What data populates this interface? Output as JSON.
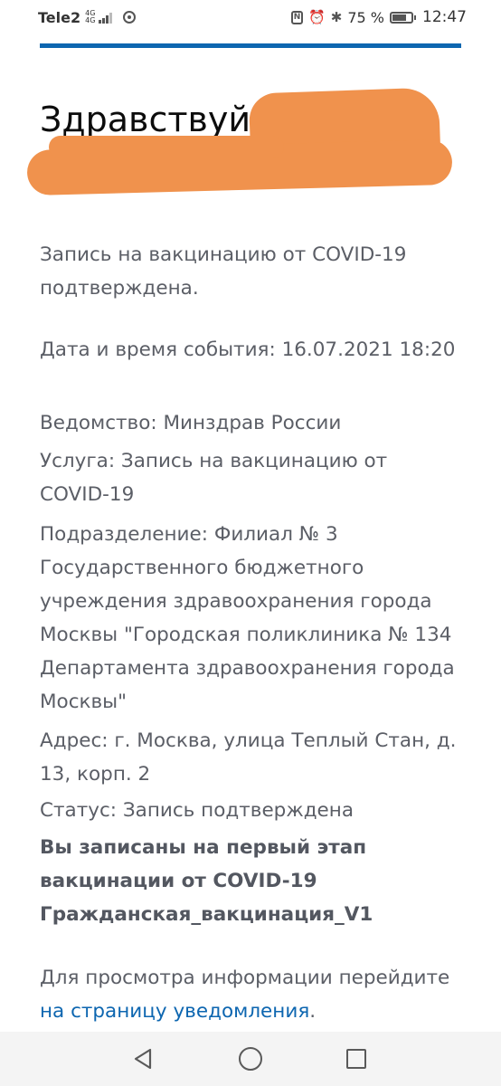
{
  "status_bar": {
    "carrier": "Tele2",
    "network_top": "4G",
    "network_bottom": "4G",
    "battery": "75 %",
    "time": "12:47",
    "icons": [
      "signal-icon",
      "chrome-icon",
      "nfc-icon",
      "alarm-icon",
      "bluetooth-icon",
      "battery-icon"
    ]
  },
  "email": {
    "greeting": "Здравствуйте,",
    "paragraphs": {
      "confirm": "Запись на вакцинацию от COVID-19 подтверждена.",
      "datetime": "Дата и время события: 16.07.2021 18:20",
      "department": "Ведомство: Минздрав России",
      "service": "Услуга: Запись на вакцинацию от COVID-19",
      "division": "Подразделение: Филиал № 3 Государственного бюджетного учреждения здравоохранения города Москвы \"Городская поликлиника № 134 Департамента здравоохранения города Москвы\"",
      "address": "Адрес: г. Москва, улица Теплый Стан, д. 13, корп. 2",
      "status": "Статус: Запись подтверждена",
      "stage": "Вы записаны на первый этап вакцинации от COVID-19 Гражданская_вакцинация_V1",
      "info_prefix": "Для просмотра информации перейдите ",
      "info_link": "на страницу уведомления",
      "info_suffix": "."
    }
  },
  "colors": {
    "accent_blue": "#0d66b0",
    "text_gray": "#5b5e66",
    "redaction_orange": "#f0924d"
  }
}
